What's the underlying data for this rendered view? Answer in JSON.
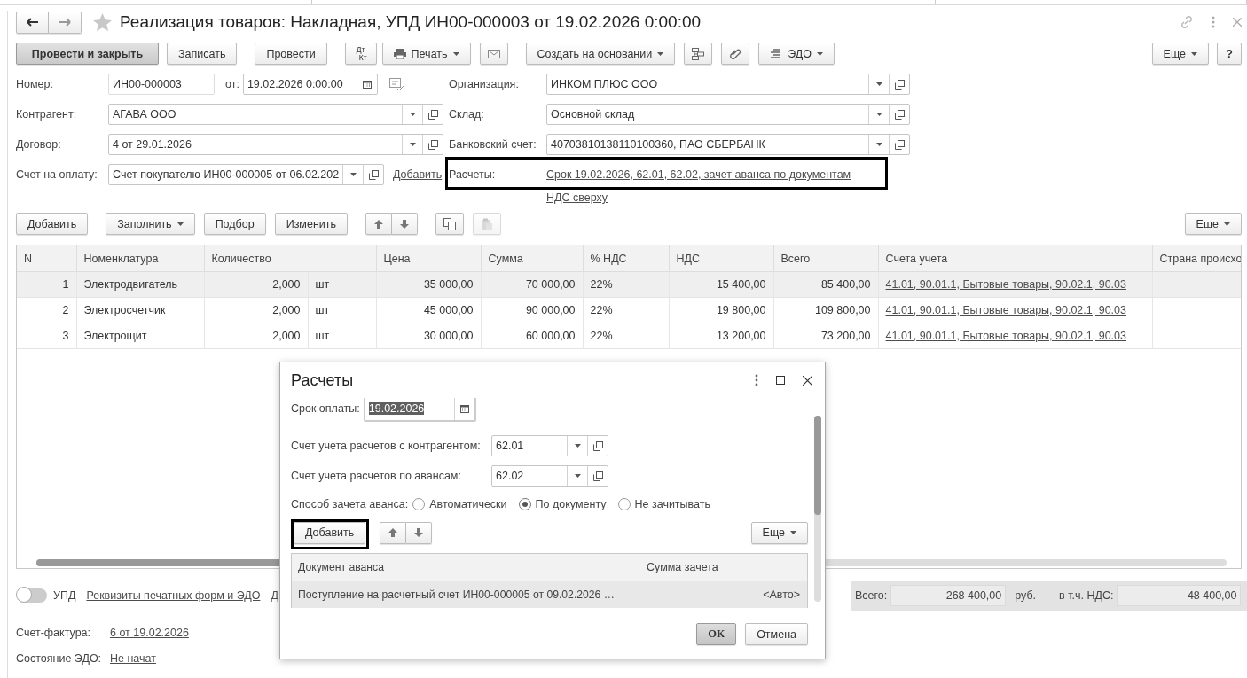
{
  "window": {
    "title": "Реализация товаров: Накладная, УПД ИН00-000003 от 19.02.2026 0:00:00"
  },
  "toolbar": {
    "post_close": "Провести и закрыть",
    "save": "Записать",
    "post": "Провести",
    "dt": "Дт",
    "kt": "Кт",
    "print": "Печать",
    "create_based": "Создать на основании",
    "edo": "ЭДО",
    "more": "Еще",
    "help": "?"
  },
  "header": {
    "number": {
      "label": "Номер:",
      "value": "ИН00-000003"
    },
    "date": {
      "label": "от:",
      "value": "19.02.2026  0:00:00"
    },
    "contractor": {
      "label": "Контрагент:",
      "value": "АГАВА  ООО"
    },
    "contract": {
      "label": "Договор:",
      "value": "4 от 29.01.2026"
    },
    "invoice": {
      "label": "Счет на оплату:",
      "value": "Счет покупателю ИН00-000005 от 06.02.202",
      "link": "Добавить"
    },
    "organization": {
      "label": "Организация:",
      "value": "ИНКОМ ПЛЮС ООО"
    },
    "warehouse": {
      "label": "Склад:",
      "value": "Основной склад"
    },
    "bank_account": {
      "label": "Банковский счет:",
      "value": "40703810138110100360, ПАО СБЕРБАНК"
    },
    "settlements": {
      "label": "Расчеты:",
      "link": "Срок 19.02.2026, 62.01, 62.02, зачет аванса по документам",
      "highlighted": true
    },
    "vat_link": "НДС сверху"
  },
  "table_toolbar": {
    "add": "Добавить",
    "fill": "Заполнить",
    "pick": "Подбор",
    "change": "Изменить",
    "paste_disabled": true,
    "more": "Еще"
  },
  "table": {
    "columns": [
      "N",
      "Номенклатура",
      "Количество",
      "Цена",
      "Сумма",
      "% НДС",
      "НДС",
      "Всего",
      "Счета учета",
      "Страна происхо"
    ],
    "rows": [
      {
        "selected": true,
        "n": "1",
        "item": "Электродвигатель",
        "qty": "2,000",
        "unit": "шт",
        "price": "35 000,00",
        "sum": "70 000,00",
        "vat_rate": "22%",
        "vat": "15 400,00",
        "total": "85 400,00",
        "accounts": "41.01, 90.01.1, Бытовые товары, 90.02.1, 90.03"
      },
      {
        "selected": false,
        "n": "2",
        "item": "Электросчетчик",
        "qty": "2,000",
        "unit": "шт",
        "price": "45 000,00",
        "sum": "90 000,00",
        "vat_rate": "22%",
        "vat": "19 800,00",
        "total": "109 800,00",
        "accounts": "41.01, 90.01.1, Бытовые товары, 90.02.1, 90.03"
      },
      {
        "selected": false,
        "n": "3",
        "item": "Электрощит",
        "qty": "2,000",
        "unit": "шт",
        "price": "30 000,00",
        "sum": "60 000,00",
        "vat_rate": "22%",
        "vat": "13 200,00",
        "total": "73 200,00",
        "accounts": "41.01, 90.01.1, Бытовые товары, 90.02.1, 90.03"
      }
    ]
  },
  "footer": {
    "upd": {
      "label": "УПД",
      "on": false
    },
    "links": [
      "Реквизиты печатных форм и ЭДО",
      "Д"
    ],
    "totals": {
      "total_label": "Всего:",
      "total": "268 400,00",
      "currency": "руб.",
      "vat_label": "в т.ч. НДС:",
      "vat": "48 400,00"
    },
    "invoice": {
      "label": "Счет-фактура:",
      "link": "6 от 19.02.2026"
    },
    "edo": {
      "label": "Состояние ЭДО:",
      "link": "Не начат"
    }
  },
  "dialog": {
    "title": "Расчеты",
    "due": {
      "label": "Срок оплаты:",
      "value": "19.02.2026"
    },
    "account": {
      "label": "Счет учета расчетов с контрагентом:",
      "value": "62.01"
    },
    "advance_account": {
      "label": "Счет учета расчетов по авансам:",
      "value": "62.02"
    },
    "method": {
      "label": "Способ зачета аванса:",
      "options": [
        {
          "label": "Автоматически",
          "selected": false
        },
        {
          "label": "По документу",
          "selected": true
        },
        {
          "label": "Не зачитывать",
          "selected": false
        }
      ]
    },
    "add": {
      "label": "Добавить",
      "highlighted": true
    },
    "more": "Еще",
    "columns": [
      "Документ аванса",
      "Сумма зачета"
    ],
    "rows": [
      {
        "selected": true,
        "document": "Поступление на расчетный счет ИН00-000005 от 09.02.2026 …",
        "amount": "<Авто>"
      }
    ],
    "ok": "ОК",
    "cancel": "Отмена"
  }
}
